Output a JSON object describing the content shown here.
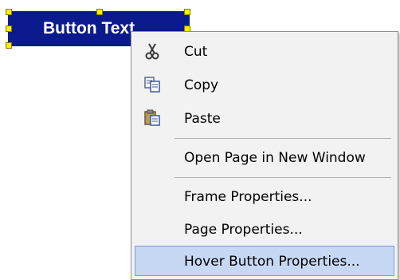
{
  "canvas": {
    "button_text": "Button Text",
    "button_color": "#0a1a8c",
    "handle_color": "#ffee00"
  },
  "context_menu": {
    "items": [
      {
        "label": "Cut",
        "icon": "scissors-icon"
      },
      {
        "label": "Copy",
        "icon": "copy-icon"
      },
      {
        "label": "Paste",
        "icon": "paste-icon"
      },
      {
        "label": "Open Page in New Window"
      },
      {
        "label": "Frame Properties..."
      },
      {
        "label": "Page Properties..."
      },
      {
        "label": "Hover Button Properties...",
        "state": "highlighted"
      }
    ],
    "highlight_color": "#c7d8f5"
  }
}
